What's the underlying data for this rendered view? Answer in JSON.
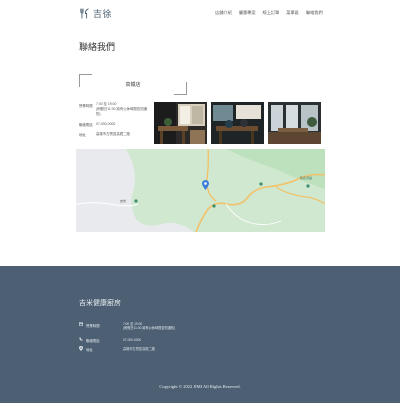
{
  "header": {
    "logo_text": "吉徐",
    "nav": [
      "店舖介紹",
      "優惠專案",
      "線上訂單",
      "菜單區",
      "聯絡我們"
    ]
  },
  "page_title": "聯絡我們",
  "store": {
    "name": "高鐵店",
    "rows": [
      {
        "label": "營業時間",
        "value": "7:00 至 19:00\n(例假日11:00 將有公休時間告知通知)"
      },
      {
        "label": "聯絡電話",
        "value": "07-000-0000"
      },
      {
        "label": "地址",
        "value": "高雄市左營區高鐵二路"
      }
    ]
  },
  "map": {
    "place_label": "知名景點",
    "place_label_2": "吉米"
  },
  "footer": {
    "title": "吉米健康廚房",
    "rows": [
      {
        "icon": "calendar-icon",
        "label": "營業時間",
        "value": "7:00 至 19:00\n(例假日11:00 將有公休時間告知通知)"
      },
      {
        "icon": "phone-icon",
        "label": "聯絡電話",
        "value": "07-000-0000"
      },
      {
        "icon": "location-pin-icon",
        "label": "地址",
        "value": "高雄市左營區高鐵二路"
      }
    ],
    "copyright": "Copyright © 2022 JIMI All Rights Reserved."
  },
  "colors": {
    "footer_bg": "#4d6073",
    "map_green": "#cfe8cf",
    "road": "#f2c26b",
    "pin": "#3b7dd8"
  }
}
